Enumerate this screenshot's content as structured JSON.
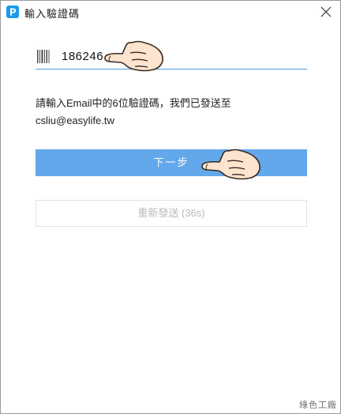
{
  "window": {
    "title": "輸入驗證碼",
    "app_icon": "p-logo-icon",
    "close_icon": "close-icon"
  },
  "code_field": {
    "icon": "barcode-icon",
    "value": "186246"
  },
  "hint": {
    "line1": "請輸入Email中的6位驗證碼，我們已發送至",
    "line2": "csliu@easylife.tw"
  },
  "buttons": {
    "next_label": "下一步",
    "resend_label": "重新發送 (36s)"
  },
  "annotations": {
    "pointer_icon": "pointing-hand-icon"
  },
  "watermark": "綠色工廠",
  "colors": {
    "accent": "#62a8ea",
    "field_underline": "#4a9ee6",
    "disabled_text": "#b9b9b9",
    "app_icon": "#1e9be8"
  }
}
